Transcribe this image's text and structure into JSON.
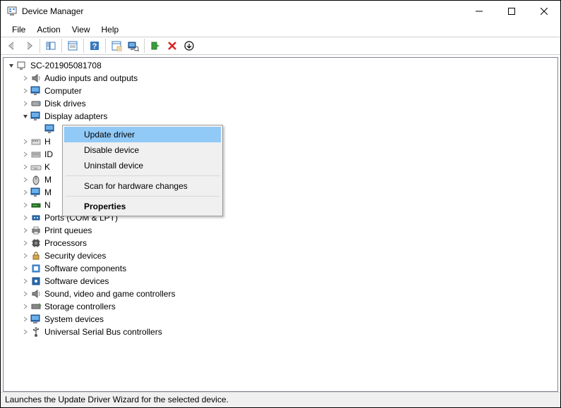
{
  "titlebar": {
    "title": "Device Manager"
  },
  "menubar": {
    "file": "File",
    "action": "Action",
    "view": "View",
    "help": "Help"
  },
  "tree": {
    "root": "SC-201905081708",
    "items": [
      {
        "label": "Audio inputs and outputs",
        "icon": "audio"
      },
      {
        "label": "Computer",
        "icon": "monitor"
      },
      {
        "label": "Disk drives",
        "icon": "disk"
      },
      {
        "label": "Display adapters",
        "icon": "monitor",
        "expanded": true,
        "child": ""
      },
      {
        "label": "H",
        "icon": "hid"
      },
      {
        "label": "ID",
        "icon": "ide"
      },
      {
        "label": "K",
        "icon": "keyboard"
      },
      {
        "label": "M",
        "icon": "mouse"
      },
      {
        "label": "M",
        "icon": "monitor"
      },
      {
        "label": "N",
        "icon": "network"
      },
      {
        "label": "Ports (COM & LPT)",
        "icon": "port"
      },
      {
        "label": "Print queues",
        "icon": "printer"
      },
      {
        "label": "Processors",
        "icon": "cpu"
      },
      {
        "label": "Security devices",
        "icon": "security"
      },
      {
        "label": "Software components",
        "icon": "swcomp"
      },
      {
        "label": "Software devices",
        "icon": "swdev"
      },
      {
        "label": "Sound, video and game controllers",
        "icon": "audio"
      },
      {
        "label": "Storage controllers",
        "icon": "storage"
      },
      {
        "label": "System devices",
        "icon": "system"
      },
      {
        "label": "Universal Serial Bus controllers",
        "icon": "usb"
      }
    ]
  },
  "context_menu": {
    "update": "Update driver",
    "disable": "Disable device",
    "uninstall": "Uninstall device",
    "scan": "Scan for hardware changes",
    "properties": "Properties"
  },
  "statusbar": {
    "text": "Launches the Update Driver Wizard for the selected device."
  }
}
